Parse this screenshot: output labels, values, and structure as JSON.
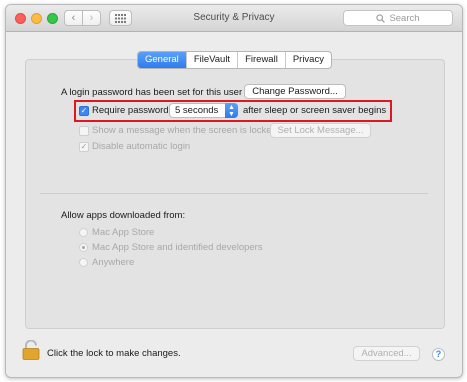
{
  "window": {
    "title": "Security & Privacy",
    "search_placeholder": "Search"
  },
  "tabs": [
    {
      "label": "General",
      "active": true
    },
    {
      "label": "FileVault",
      "active": false
    },
    {
      "label": "Firewall",
      "active": false
    },
    {
      "label": "Privacy",
      "active": false
    }
  ],
  "general": {
    "login_password_text": "A login password has been set for this user",
    "change_password_label": "Change Password...",
    "require_password_label": "Require password",
    "require_password_checked": true,
    "require_password_delay": "5 seconds",
    "after_sleep_text": "after sleep or screen saver begins",
    "show_message_label": "Show a message when the screen is locked",
    "show_message_checked": false,
    "set_lock_message_label": "Set Lock Message...",
    "disable_auto_login_label": "Disable automatic login",
    "disable_auto_login_checked": true
  },
  "allow_apps": {
    "heading": "Allow apps downloaded from:",
    "options": [
      {
        "label": "Mac App Store",
        "selected": false
      },
      {
        "label": "Mac App Store and identified developers",
        "selected": true
      },
      {
        "label": "Anywhere",
        "selected": false
      }
    ]
  },
  "footer": {
    "lock_text": "Click the lock to make changes.",
    "advanced_label": "Advanced...",
    "help_label": "?"
  },
  "colors": {
    "accent": "#3b87f3",
    "highlight_box": "#e0171f",
    "lock": "#e0a52c"
  }
}
